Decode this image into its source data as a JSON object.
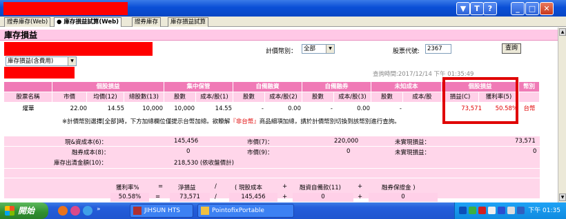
{
  "tabs": [
    {
      "label": "證券庫存(Web)"
    },
    {
      "label": "● 庫存損益試算(Web)"
    },
    {
      "label": "證券庫存"
    },
    {
      "label": "庫存損益試算"
    }
  ],
  "page_title": "庫存損益",
  "filter_select": "庫存損益(含費用)",
  "currency_label": "計價幣別：",
  "currency_value": "全部",
  "stock_code_label": "股票代號:",
  "stock_code_value": "2367",
  "query_button": "查詢",
  "query_time": "查詢時間:2017/12/14 下午 01:35:49",
  "groups": [
    "個股損益",
    "集中保管",
    "自備融資",
    "自備融券",
    "未知成本",
    "個股損益",
    "幣別"
  ],
  "col_name": "股票名稱",
  "subheaders": [
    "市價",
    "均價(12)",
    "總股數(13)",
    "股數",
    "成本/股(1)",
    "股數",
    "成本/股(2)",
    "股數",
    "成本/股(3)",
    "股數",
    "成本/股",
    "損益(C)",
    "獲利率(5)"
  ],
  "row": {
    "name": "燿華",
    "price": "22.00",
    "avg": "14.55",
    "total_shares": "10,000",
    "cs_shares": "10,000",
    "cs_cost": "14.55",
    "fin_shares": "-",
    "fin_cost": "0.00",
    "sec_shares": "-",
    "sec_cost": "0.00",
    "unk_shares": "-",
    "pl": "73,571",
    "roi": "50.58%",
    "currency": "台幣"
  },
  "note": {
    "pre": "※計價幣別選擇[全部]時，下方加總欄位僅提示台幣加總。欲瞭解",
    "highlight": "『非台幣』",
    "post": "商品細項加總，請於計價幣別切換到該幣別進行查詢。"
  },
  "summary": {
    "cash_cost_label": "現&資成本(6)：",
    "cash_cost_value": "145,456",
    "mv7_label": "市價(7)：",
    "mv7_value": "220,000",
    "unreal1_label": "未實現損益：",
    "unreal1_value": "73,571",
    "sec_cost_label": "融券成本(8)：",
    "sec_cost_value": "0",
    "mv9_label": "市價(9)：",
    "mv9_value": "0",
    "unreal2_label": "未實現損益：",
    "unreal2_value": "0",
    "outgoing_label": "庫存出清金額(10)：",
    "outgoing_value": "218,530 (依收盤價計)"
  },
  "formula": {
    "h_roi": "獲利率%",
    "eq": "=",
    "h_net": "淨損益",
    "div": "/",
    "h_cost": "( 現股成本",
    "plus1": "+",
    "h_margin": "融資自備款(11)",
    "plus2": "+",
    "h_deposit": "融券保證金 )",
    "v_roi": "50.58%",
    "v_net": "73,571",
    "v_cost": "145,456",
    "v_margin": "0",
    "v_deposit": "0"
  },
  "taskbar": {
    "start": "開始",
    "tasks": [
      "JIHSUN HTS",
      "PointofixPortable"
    ],
    "clock": "下午 01:35"
  },
  "colors": {
    "accent": "#f07ab6",
    "sub": "#ffd0e8",
    "highlight": "#e00000",
    "titlebar": "#0a4fd6"
  }
}
